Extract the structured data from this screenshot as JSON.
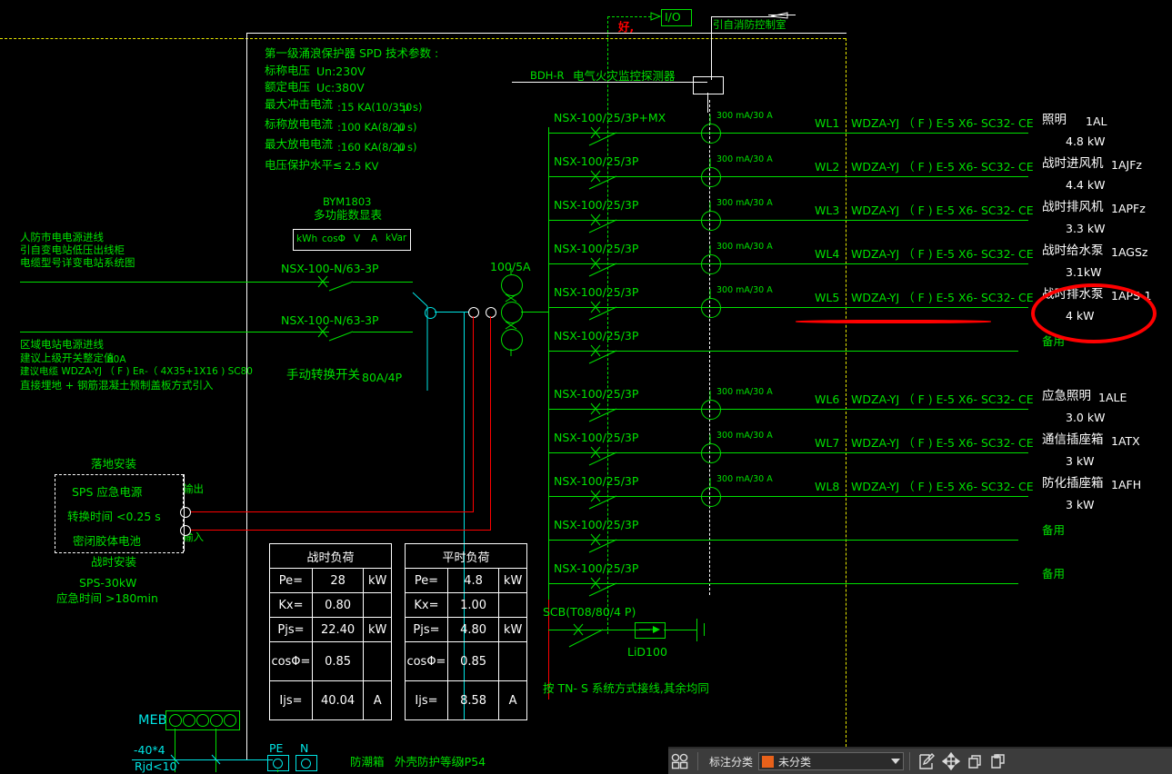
{
  "drawing": {
    "spd": {
      "title": "第一级涌浪保护器    SPD  技术参数  :",
      "lines": [
        {
          "label": "标称电压",
          "value": "Un:230V"
        },
        {
          "label": "额定电压",
          "value": "Uc:380V"
        },
        {
          "label": "最大冲击电流",
          "value": ":15 KA(10/350",
          "unit": "μ s)"
        },
        {
          "label": "标称放电电流",
          "value": ":100 KA(8/20",
          "unit": "μ s)"
        },
        {
          "label": "最大放电电流",
          "value": ":160 KA(8/20",
          "unit": "μ s)"
        },
        {
          "label": "电压保护水平≤",
          "value": "2.5 KV"
        }
      ]
    },
    "meter": {
      "model": "BYM1803",
      "title": "多功能数显表",
      "fields": [
        "kWh",
        "cosΦ",
        "V",
        "A",
        "kVar"
      ]
    },
    "incoming_top": {
      "l1": "人防市电电源进线",
      "l2": "引自变电站低压出线柜",
      "l3": "电缆型号详变电站系统图"
    },
    "incoming_bottom": {
      "l1": "区域电站电源进线",
      "l2": "建议上级开关整定值",
      "l2v": "80A",
      "l3": "建议电缆  WDZA-YJ （ F ) Eʀ-（ 4X35+1X16      ) SC80",
      "l4": "直接埋地  + 钢筋混凝土预制盖板方式引入"
    },
    "main_breakers": [
      "NSX-100-N/63-3P",
      "NSX-100-N/63-3P"
    ],
    "transfer_switch": {
      "label": "手动转换开关",
      "rating": "80A/4P"
    },
    "ct_ratio": "100/5A",
    "sps": {
      "top_note": "落地安装",
      "l1": "SPS 应急电源",
      "l2": "转换时间  <0.25 s",
      "l3": "密闭胶体电池",
      "out": "输出",
      "in": "输入",
      "bottom_note": "战时安装",
      "model": "SPS-30kW",
      "time": "应急时间  >180min"
    },
    "top_monitor": {
      "io": "I/O",
      "red_mark": "好,",
      "from_room": "引自消防控制室",
      "detector_code": "BDH-R",
      "detector_name": "电气火灾监控探测器"
    },
    "feeders": [
      {
        "breaker": "NSX-100/25/3P+MX",
        "rcd": "300 mA/30 A",
        "circuit": "WL1",
        "cable": "WDZA-YJ （ F ) E-5 X6- SC32- CE",
        "load": "照明",
        "tag": "1AL",
        "power": "4.8 kW"
      },
      {
        "breaker": "NSX-100/25/3P",
        "rcd": "300 mA/30 A",
        "circuit": "WL2",
        "cable": "WDZA-YJ （ F ) E-5 X6- SC32- CE",
        "load": "战时进风机",
        "tag": "1AJFz",
        "power": "4.4 kW"
      },
      {
        "breaker": "NSX-100/25/3P",
        "rcd": "300 mA/30 A",
        "circuit": "WL3",
        "cable": "WDZA-YJ （ F ) E-5 X6- SC32- CE",
        "load": "战时排风机",
        "tag": "1APFz",
        "power": "3.3 kW"
      },
      {
        "breaker": "NSX-100/25/3P",
        "rcd": "300 mA/30 A",
        "circuit": "WL4",
        "cable": "WDZA-YJ （ F ) E-5 X6- SC32- CE",
        "load": "战时给水泵",
        "tag": "1AGSz",
        "power": "3.1kW"
      },
      {
        "breaker": "NSX-100/25/3P",
        "rcd": "300 mA/30 A",
        "circuit": "WL5",
        "cable": "WDZA-YJ （ F ) E-5 X6- SC32- CE",
        "load": "战时排水泵",
        "tag": "1APS-1",
        "power": "4 kW"
      },
      {
        "breaker": "NSX-100/25/3P",
        "rcd": "",
        "circuit": "",
        "cable": "",
        "load": "备用",
        "tag": "",
        "power": ""
      },
      {
        "breaker": "NSX-100/25/3P",
        "rcd": "300 mA/30 A",
        "circuit": "WL6",
        "cable": "WDZA-YJ （ F ) E-5 X6- SC32- CE",
        "load": "应急照明",
        "tag": "1ALE",
        "power": "3.0 kW"
      },
      {
        "breaker": "NSX-100/25/3P",
        "rcd": "300 mA/30 A",
        "circuit": "WL7",
        "cable": "WDZA-YJ （ F ) E-5 X6- SC32- CE",
        "load": "通信插座箱",
        "tag": "1ATX",
        "power": "3 kW"
      },
      {
        "breaker": "NSX-100/25/3P",
        "rcd": "300 mA/30 A",
        "circuit": "WL8",
        "cable": "WDZA-YJ （ F ) E-5 X6- SC32- CE",
        "load": "防化插座箱",
        "tag": "1AFH",
        "power": "3 kW"
      },
      {
        "breaker": "NSX-100/25/3P",
        "rcd": "",
        "circuit": "",
        "cable": "",
        "load": "备用",
        "tag": "",
        "power": ""
      },
      {
        "breaker": "NSX-100/25/3P",
        "rcd": "",
        "circuit": "",
        "cable": "",
        "load": "备用",
        "tag": "",
        "power": ""
      }
    ],
    "scb": {
      "breaker": "SCB(T08/80/4 P)",
      "device": "LiD100",
      "note": "按 TN- S  系统方式接线,其余均同"
    },
    "load_tables": [
      {
        "title": "战时负荷",
        "rows": [
          {
            "k": "Pe=",
            "v": "28",
            "u": "kW"
          },
          {
            "k": "Kx=",
            "v": "0.80",
            "u": ""
          },
          {
            "k": "Pjs=",
            "v": "22.40",
            "u": "kW"
          },
          {
            "k": "cosΦ=",
            "v": "0.85",
            "u": ""
          },
          {
            "k": "Ijs=",
            "v": "40.04",
            "u": "A"
          }
        ]
      },
      {
        "title": "平时负荷",
        "rows": [
          {
            "k": "Pe=",
            "v": "4.8",
            "u": "kW"
          },
          {
            "k": "Kx=",
            "v": "1.00",
            "u": ""
          },
          {
            "k": "Pjs=",
            "v": "4.80",
            "u": "kW"
          },
          {
            "k": "cosΦ=",
            "v": "0.85",
            "u": ""
          },
          {
            "k": "Ijs=",
            "v": "8.58",
            "u": "A"
          }
        ]
      }
    ],
    "meb": {
      "label": "MEB",
      "spec": "-40*4",
      "res": "Rjd<10"
    },
    "terminals": {
      "pe": "PE",
      "n": "N",
      "box": "防潮箱",
      "ip_label": "外壳防护等级",
      "ip": "IP54"
    }
  },
  "toolbar": {
    "group_icon": "shapes-icon",
    "category_label": "标注分类",
    "selected_category": "未分类",
    "swatch_color": "#e8611a",
    "icons": [
      "edit-annotation-icon",
      "move-icon",
      "copy-icon",
      "paste-icon"
    ]
  }
}
